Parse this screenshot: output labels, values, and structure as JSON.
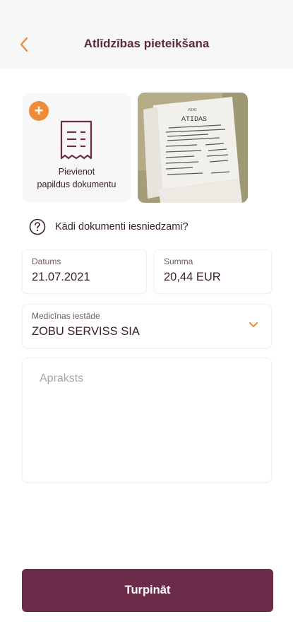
{
  "header": {
    "title": "Atlīdzības pieteikšana",
    "back_icon": "chevron-left-icon"
  },
  "documents": {
    "add_label_line1": "Pievienot",
    "add_label_line2": "papildus dokumentu",
    "add_icon": "plus-icon",
    "receipt_header": "ATIDAS",
    "count_uploaded": 1
  },
  "help": {
    "text": "Kādi dokumenti iesniedzami?",
    "icon": "question-circle-icon"
  },
  "form": {
    "date": {
      "label": "Datums",
      "value": "21.07.2021"
    },
    "amount": {
      "label": "Summa",
      "value": "20,44 EUR"
    },
    "institution": {
      "label": "Medicīnas iestāde",
      "value": "ZOBU SERVISS SIA"
    },
    "description": {
      "placeholder": "Apraksts",
      "value": ""
    }
  },
  "actions": {
    "continue_label": "Turpināt"
  },
  "colors": {
    "accent": "#ee8c3a",
    "primary": "#6b2c4a",
    "text": "#3a2030",
    "header_bg": "#f7f7f7"
  }
}
